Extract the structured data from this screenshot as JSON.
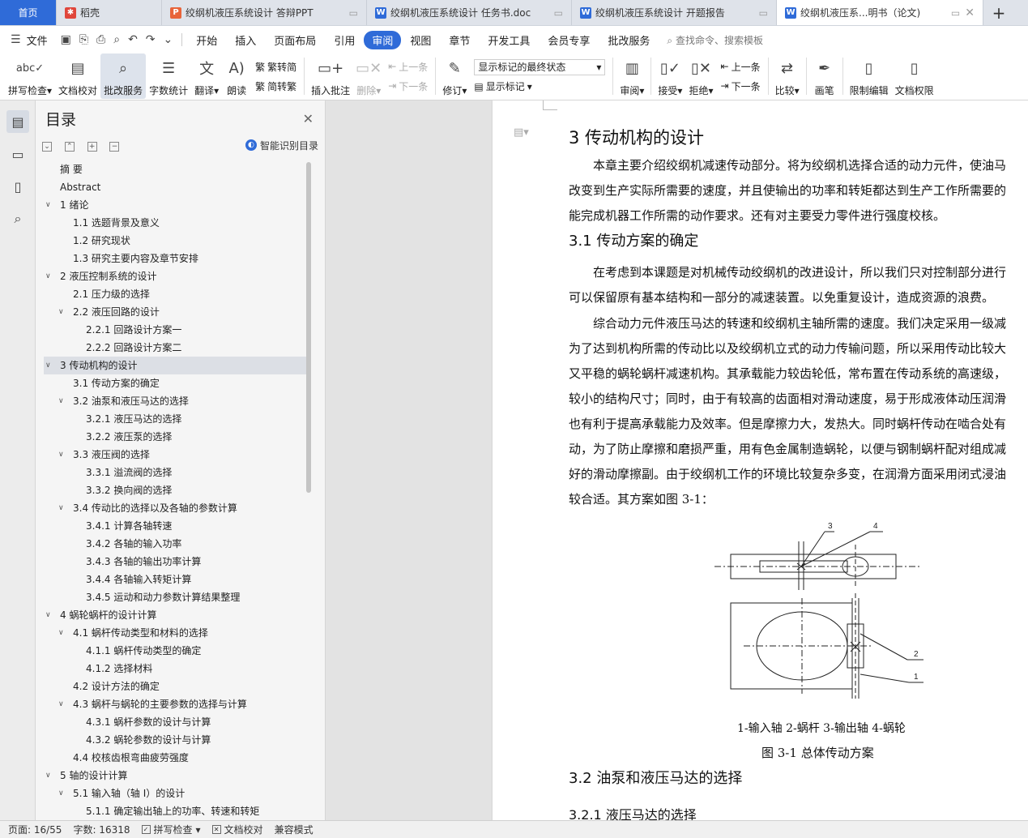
{
  "tabs": {
    "home": "首页",
    "daoke": "稻壳",
    "doc1": "绞纲机液压系统设计 答辩PPT",
    "doc2": "绞纲机液压系统设计 任务书.doc",
    "doc3": "绞纲机液压系统设计 开题报告",
    "doc4": "绞纲机液压系...明书（论文)"
  },
  "menu": {
    "file": "文件",
    "items": [
      "开始",
      "插入",
      "页面布局",
      "引用",
      "审阅",
      "视图",
      "章节",
      "开发工具",
      "会员专享",
      "批改服务"
    ],
    "search": "查找命令、搜索模板"
  },
  "ribbon": {
    "spell": "拼写检查",
    "proof": "文档校对",
    "grading": "批改服务",
    "wordcount": "字数统计",
    "translate": "翻译",
    "read": "朗读",
    "trad": "繁转简",
    "simp": "简转繁",
    "insert_comment": "插入批注",
    "delete": "删除",
    "prev": "上一条",
    "next": "下一条",
    "revise": "修订",
    "markup_select": "显示标记的最终状态",
    "show_markup": "显示标记",
    "review": "审阅",
    "accept": "接受",
    "reject": "拒绝",
    "prev2": "上一条",
    "next2": "下一条",
    "compare": "比较",
    "pen": "画笔",
    "restrict": "限制编辑",
    "perm": "文档权限"
  },
  "toc": {
    "title": "目录",
    "smart": "智能识别目录",
    "items": [
      {
        "text": "摘    要",
        "level": 0,
        "chev": false
      },
      {
        "text": "Abstract",
        "level": 0,
        "chev": false
      },
      {
        "text": "1  绪论",
        "level": 0,
        "chev": true
      },
      {
        "text": "1.1 选题背景及意义",
        "level": 1,
        "chev": false
      },
      {
        "text": "1.2 研究现状",
        "level": 1,
        "chev": false
      },
      {
        "text": "1.3 研究主要内容及章节安排",
        "level": 1,
        "chev": false
      },
      {
        "text": "2  液压控制系统的设计",
        "level": 0,
        "chev": true
      },
      {
        "text": "2.1 压力级的选择",
        "level": 1,
        "chev": false
      },
      {
        "text": "2.2  液压回路的设计",
        "level": 1,
        "chev": true
      },
      {
        "text": "2.2.1  回路设计方案一",
        "level": 2,
        "chev": false
      },
      {
        "text": "2.2.2  回路设计方案二",
        "level": 2,
        "chev": false
      },
      {
        "text": "3  传动机构的设计",
        "level": 0,
        "chev": true,
        "active": true
      },
      {
        "text": "3.1 传动方案的确定",
        "level": 1,
        "chev": false
      },
      {
        "text": "3.2 油泵和液压马达的选择",
        "level": 1,
        "chev": true
      },
      {
        "text": "3.2.1  液压马达的选择",
        "level": 2,
        "chev": false
      },
      {
        "text": "3.2.2  液压泵的选择",
        "level": 2,
        "chev": false
      },
      {
        "text": "3.3  液压阀的选择",
        "level": 1,
        "chev": true
      },
      {
        "text": "3.3.1  溢流阀的选择",
        "level": 2,
        "chev": false
      },
      {
        "text": "3.3.2  换向阀的选择",
        "level": 2,
        "chev": false
      },
      {
        "text": "3.4    传动比的选择以及各轴的参数计算",
        "level": 1,
        "chev": true
      },
      {
        "text": "3.4.1    计算各轴转速",
        "level": 2,
        "chev": false
      },
      {
        "text": "3.4.2    各轴的输入功率",
        "level": 2,
        "chev": false
      },
      {
        "text": "3.4.3    各轴的输出功率计算",
        "level": 2,
        "chev": false
      },
      {
        "text": "3.4.4    各轴输入转矩计算",
        "level": 2,
        "chev": false
      },
      {
        "text": "3.4.5 运动和动力参数计算结果整理",
        "level": 2,
        "chev": false
      },
      {
        "text": "4  蜗轮蜗杆的设计计算",
        "level": 0,
        "chev": true
      },
      {
        "text": "4.1 蜗杆传动类型和材料的选择",
        "level": 1,
        "chev": true
      },
      {
        "text": "4.1.1 蜗杆传动类型的确定",
        "level": 2,
        "chev": false
      },
      {
        "text": "4.1.2 选择材料",
        "level": 2,
        "chev": false
      },
      {
        "text": "4.2  设计方法的确定",
        "level": 1,
        "chev": false
      },
      {
        "text": "4.3  蜗杆与蜗轮的主要参数的选择与计算",
        "level": 1,
        "chev": true
      },
      {
        "text": "4.3.1  蜗杆参数的设计与计算",
        "level": 2,
        "chev": false
      },
      {
        "text": "4.3.2  蜗轮参数的设计与计算",
        "level": 2,
        "chev": false
      },
      {
        "text": "4.4  校核齿根弯曲疲劳强度",
        "level": 1,
        "chev": false
      },
      {
        "text": "5  轴的设计计算",
        "level": 0,
        "chev": true
      },
      {
        "text": "5.1  输入轴（轴 I）的设计",
        "level": 1,
        "chev": true
      },
      {
        "text": "5.1.1  确定输出轴上的功率、转速和转矩",
        "level": 2,
        "chev": false
      }
    ]
  },
  "doc": {
    "h1": "3  传动机构的设计",
    "p1": [
      "　　本章主要介绍绞纲机减速传动部分。将为绞纲机选择合适的动力元件，使油马",
      "改变到生产实际所需要的速度，并且使输出的功率和转矩都达到生产工作所需要的",
      "能完成机器工作所需的动作要求。还有对主要受力零件进行强度校核。"
    ],
    "h2a": "3.1 传动方案的确定",
    "p2": [
      "　　在考虑到本课题是对机械传动绞纲机的改进设计，所以我们只对控制部分进行",
      "可以保留原有基本结构和一部分的减速装置。以免重复设计，造成资源的浪费。"
    ],
    "p3": [
      "　　综合动力元件液压马达的转速和绞纲机主轴所需的速度。我们决定采用一级减",
      "为了达到机构所需的传动比以及绞纲机立式的动力传输问题，所以采用传动比较大",
      "又平稳的蜗轮蜗杆减速机构。其承载能力较齿轮低，常布置在传动系统的高速级，",
      "较小的结构尺寸；同时，由于有较高的齿面相对滑动速度，易于形成液体动压润滑",
      "也有利于提高承载能力及效率。但是摩擦力大，发热大。同时蜗杆传动在啮合处有",
      "动，为了防止摩擦和磨损严重，用有色金属制造蜗轮，以便与钢制蜗杆配对组成减",
      "好的滑动摩擦副。由于绞纲机工作的环境比较复杂多变，在润滑方面采用闭式浸油",
      "较合适。其方案如图 3-1："
    ],
    "fig_labels": {
      "l1": "1",
      "l2": "2",
      "l3": "3",
      "l4": "4"
    },
    "fig_legend": "1-输入轴  2-蜗杆  3-输出轴  4-蜗轮",
    "fig_caption": "图 3-1  总体传动方案",
    "h2b": "3.2 油泵和液压马达的选择",
    "h3": "3.2.1  液压马达的选择"
  },
  "status": {
    "page": "页面: 16/55",
    "words": "字数: 16318",
    "spell": "拼写检查",
    "proof": "文档校对",
    "compat": "兼容模式"
  }
}
